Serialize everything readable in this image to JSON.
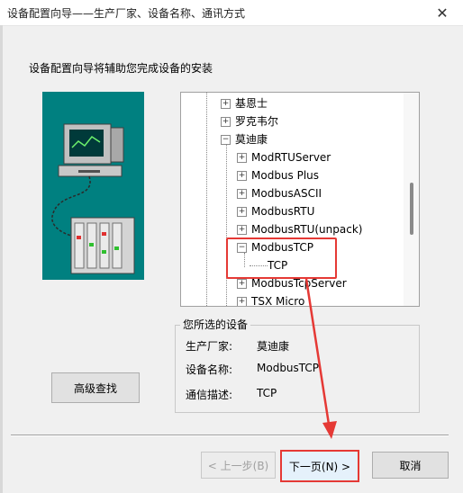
{
  "window": {
    "title": "设备配置向导——生产厂家、设备名称、通讯方式",
    "close_glyph": "✕"
  },
  "intro_text": "设备配置向导将辅助您完成设备的安装",
  "illustration": {
    "icon_name": "computer-to-plc-icon",
    "background_color": "#008080"
  },
  "tree": {
    "items": [
      {
        "label": "基恩士",
        "expander": "+"
      },
      {
        "label": "罗克韦尔",
        "expander": "+"
      },
      {
        "label": "莫迪康",
        "expander": "−"
      },
      {
        "label": "ModRTUServer",
        "expander": "+"
      },
      {
        "label": "Modbus Plus",
        "expander": "+"
      },
      {
        "label": "ModbusASCII",
        "expander": "+"
      },
      {
        "label": "ModbusRTU",
        "expander": "+"
      },
      {
        "label": "ModbusRTU(unpack)",
        "expander": "+"
      },
      {
        "label": "ModbusTCP",
        "expander": "−"
      },
      {
        "label": "TCP",
        "expander": ""
      },
      {
        "label": "ModbusTcpServer",
        "expander": "+"
      },
      {
        "label": "TSX Micro",
        "expander": "+"
      }
    ]
  },
  "selected_device": {
    "group_title": "您所选的设备",
    "manufacturer_label": "生产厂家:",
    "manufacturer_value": "莫迪康",
    "device_name_label": "设备名称:",
    "device_name_value": "ModbusTCP",
    "comm_label": "通信描述:",
    "comm_value": "TCP"
  },
  "buttons": {
    "advanced_search": "高级查找",
    "prev": "< 上一步(B)",
    "next": "下一页(N) >",
    "cancel": "取消"
  },
  "colors": {
    "annotation_red": "#e53935",
    "dialog_bg": "#f0f0f0"
  }
}
